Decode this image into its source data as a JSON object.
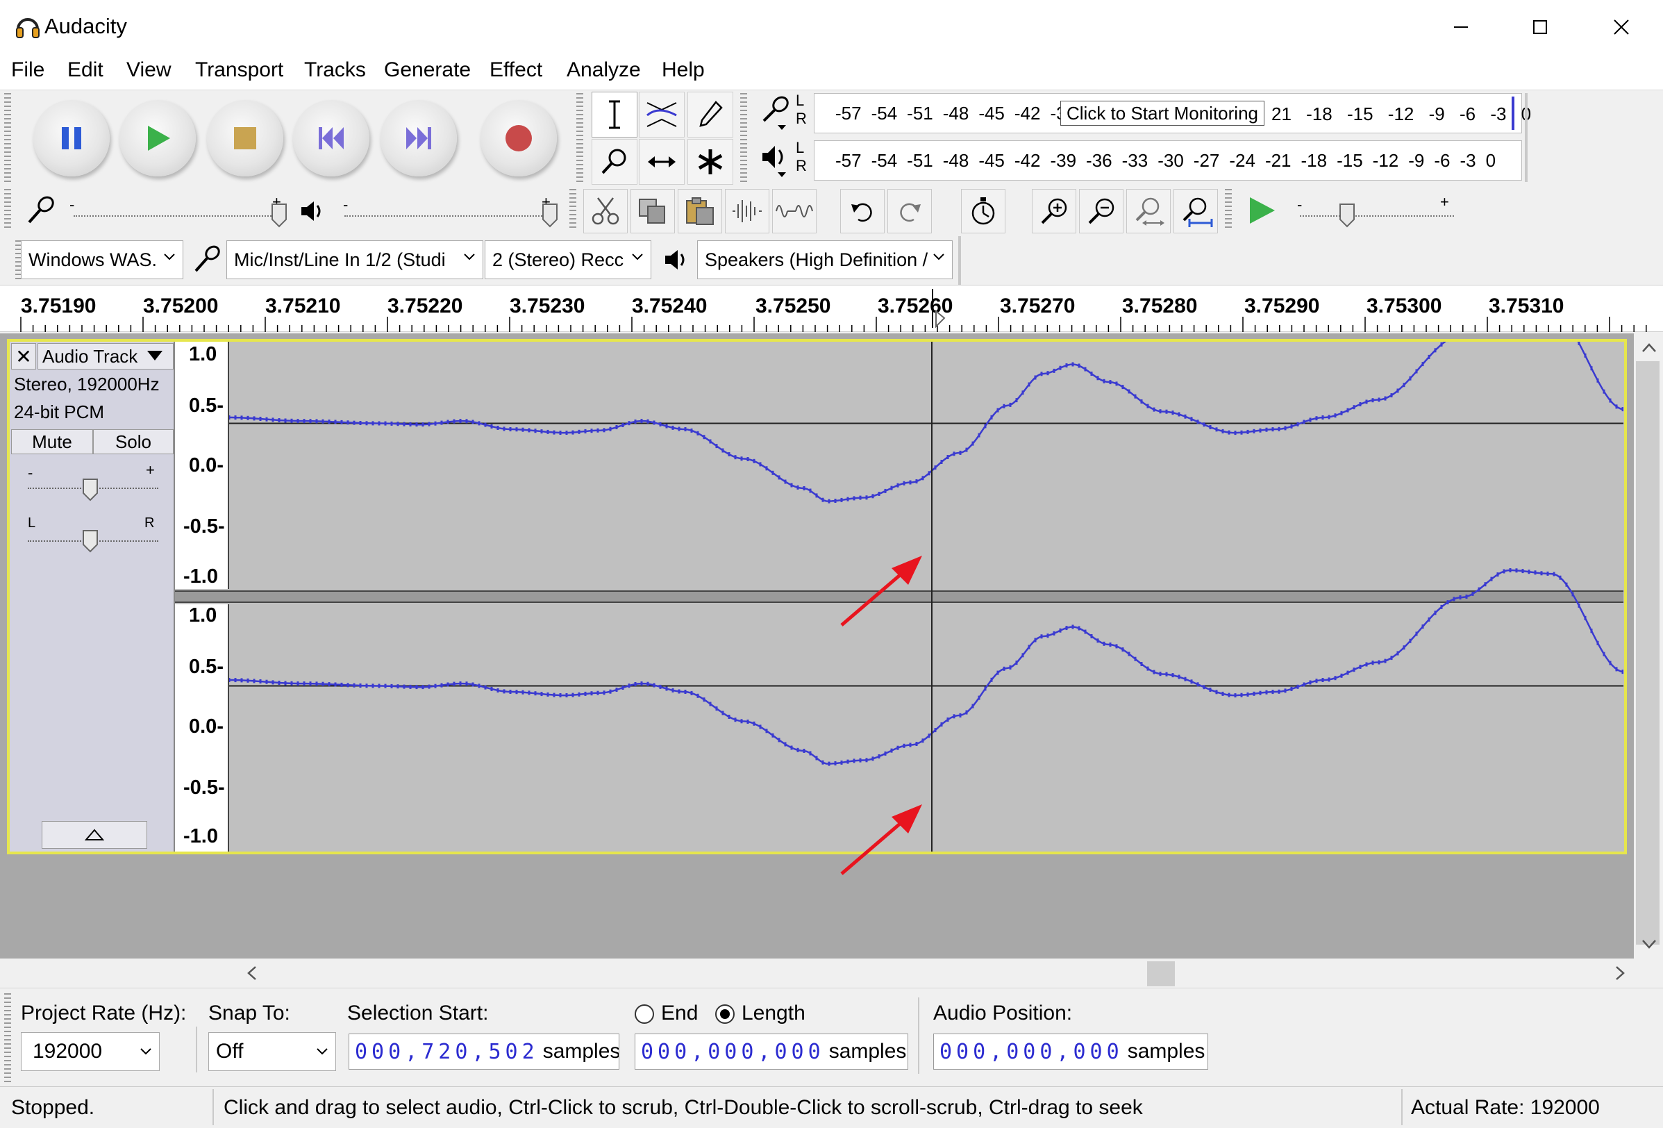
{
  "window": {
    "title": "Audacity",
    "controls": {
      "minimize": "—",
      "maximize": "☐",
      "close": "✕"
    }
  },
  "menu": [
    {
      "label": "File"
    },
    {
      "label": "Edit"
    },
    {
      "label": "View"
    },
    {
      "label": "Transport"
    },
    {
      "label": "Tracks"
    },
    {
      "label": "Generate"
    },
    {
      "label": "Effect"
    },
    {
      "label": "Analyze"
    },
    {
      "label": "Help"
    }
  ],
  "meters": {
    "record_scale": [
      "-57",
      "-54",
      "-51",
      "-48",
      "-45",
      "-42",
      "-3"
    ],
    "record_scale_tail": [
      "21",
      "-18",
      "-15",
      "-12",
      "-9",
      "-6",
      "-3",
      "0"
    ],
    "record_tooltip": "Click to Start Monitoring",
    "playback_scale": [
      "-57",
      "-54",
      "-51",
      "-48",
      "-45",
      "-42",
      "-39",
      "-36",
      "-33",
      "-30",
      "-27",
      "-24",
      "-21",
      "-18",
      "-15",
      "-12",
      "-9",
      "-6",
      "-3",
      "0"
    ],
    "lr_top": "L",
    "lr_bottom": "R"
  },
  "mixer": {
    "minus": "-",
    "plus": "+"
  },
  "devices": {
    "host": "Windows WAS.",
    "input": "Mic/Inst/Line In 1/2 (Studi",
    "channels": "2 (Stereo) Recc",
    "output": "Speakers (High Definition /"
  },
  "ruler": {
    "ticks": [
      "3.75190",
      "3.75200",
      "3.75210",
      "3.75220",
      "3.75230",
      "3.75240",
      "3.75250",
      "3.75260",
      "3.75270",
      "3.75280",
      "3.75290",
      "3.75300",
      "3.75310"
    ]
  },
  "track": {
    "name": "Audio Track",
    "close": "✕",
    "info_line1": "Stereo, 192000Hz",
    "info_line2": "24-bit PCM",
    "mute": "Mute",
    "solo": "Solo",
    "gain_minus": "-",
    "gain_plus": "+",
    "pan_left": "L",
    "pan_right": "R",
    "collapse": "▲",
    "vruler_labels": [
      "1.0",
      "0.5-",
      "0.0-",
      "-0.5-",
      "-1.0"
    ],
    "waveform_color": "#3a3ad0"
  },
  "selection": {
    "project_rate_label": "Project Rate (Hz):",
    "project_rate": "192000",
    "snap_label": "Snap To:",
    "snap_value": "Off",
    "selection_start_label": "Selection Start:",
    "selection_start_digits": "000,720,502",
    "end_label": "End",
    "length_label": "Length",
    "length_digits": "000,000,000",
    "audio_position_label": "Audio Position:",
    "audio_position_digits": "000,000,000",
    "unit": "samples"
  },
  "status": {
    "state": "Stopped.",
    "hint": "Click and drag to select audio, Ctrl-Click to scrub, Ctrl-Double-Click to scroll-scrub, Ctrl-drag to seek",
    "actual_rate": "Actual Rate: 192000"
  }
}
